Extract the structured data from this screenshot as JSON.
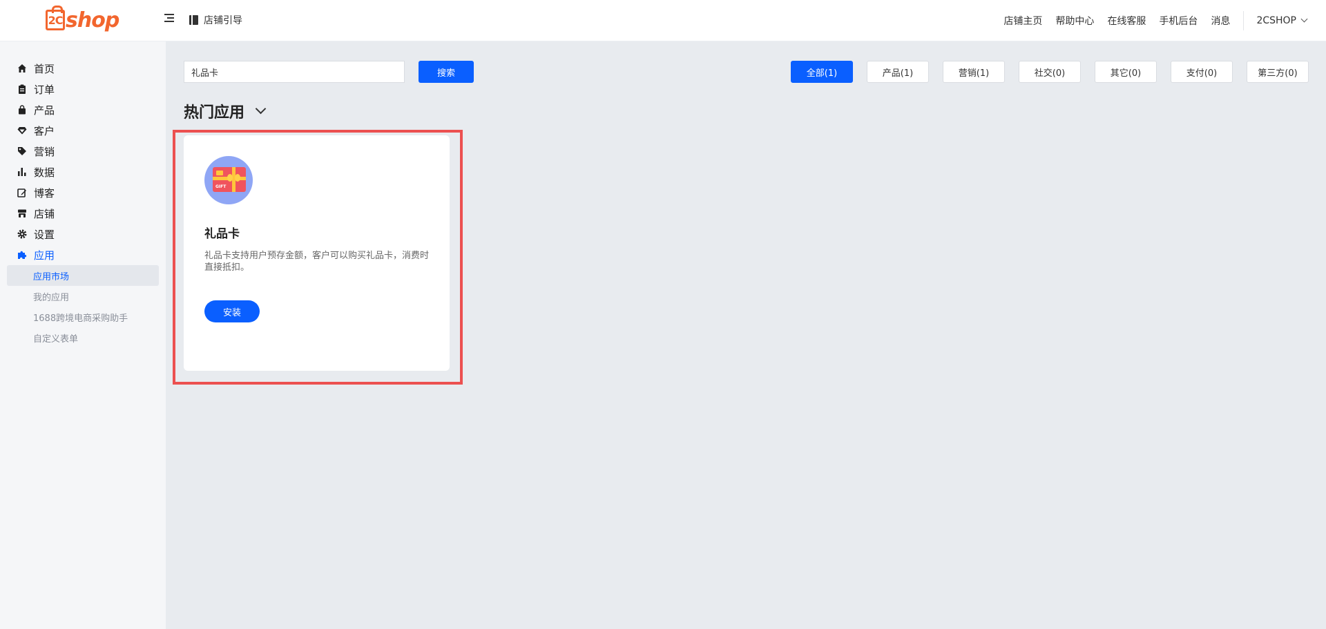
{
  "header": {
    "logo_text": "2Cshop",
    "guide_label": "店铺引导",
    "links": [
      "店铺主页",
      "帮助中心",
      "在线客服",
      "手机后台",
      "消息"
    ],
    "user_label": "2CSHOP"
  },
  "sidebar": {
    "items": [
      {
        "label": "首页",
        "icon": "home-icon"
      },
      {
        "label": "订单",
        "icon": "clipboard-icon"
      },
      {
        "label": "产品",
        "icon": "bag-icon"
      },
      {
        "label": "客户",
        "icon": "diamond-icon"
      },
      {
        "label": "营销",
        "icon": "tag-icon"
      },
      {
        "label": "数据",
        "icon": "bar-chart-icon"
      },
      {
        "label": "博客",
        "icon": "edit-icon"
      },
      {
        "label": "店铺",
        "icon": "store-icon"
      },
      {
        "label": "设置",
        "icon": "gear-icon"
      },
      {
        "label": "应用",
        "icon": "puzzle-icon"
      }
    ],
    "sub_items": [
      {
        "label": "应用市场"
      },
      {
        "label": "我的应用"
      },
      {
        "label": "1688跨境电商采购助手"
      },
      {
        "label": "自定义表单"
      }
    ]
  },
  "search": {
    "value": "礼品卡",
    "button_label": "搜索"
  },
  "filters": [
    "全部(1)",
    "产品(1)",
    "营销(1)",
    "社交(0)",
    "其它(0)",
    "支付(0)",
    "第三方(0)"
  ],
  "section_title": "热门应用",
  "app_card": {
    "name": "礼品卡",
    "description": "礼品卡支持用户预存金额，客户可以购买礼品卡，消费时直接抵扣。",
    "install_label": "安装",
    "icon_text": "GIFT"
  },
  "colors": {
    "accent": "#0a5fff",
    "brand": "#f2662e",
    "highlight": "#ec5050"
  }
}
